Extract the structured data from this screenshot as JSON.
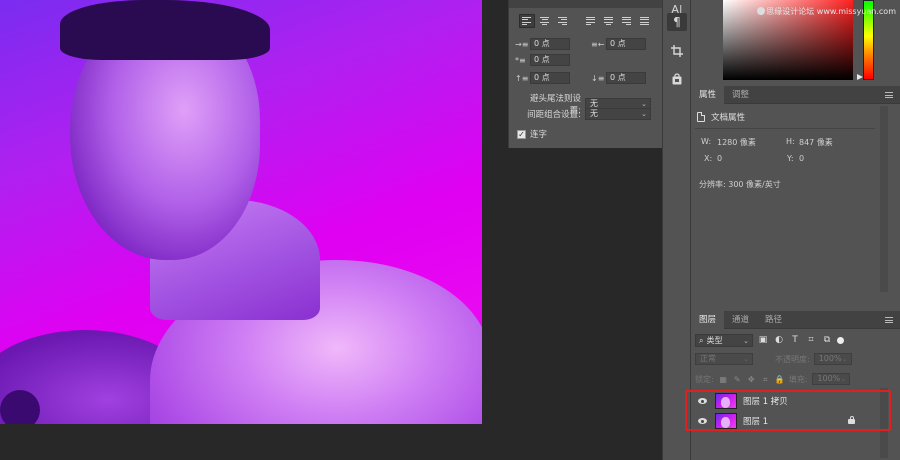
{
  "paragraph_panel": {
    "tabs": [
      "",
      ""
    ],
    "indent_left": "0 点",
    "indent_right": "0 点",
    "first_line": "0 点",
    "space_before": "0 点",
    "space_after": "0 点",
    "hyphen_rule_label": "避头尾法则设置:",
    "hyphen_rule_value": "无",
    "spacing_combo_label": "间距组合设置:",
    "spacing_combo_value": "无",
    "hyphenate_label": "连字"
  },
  "tool_strip": {
    "items": [
      "A|",
      "¶",
      "crop",
      "bag"
    ]
  },
  "watermark": "思缘设计论坛 www.missyuan.com",
  "properties_panel": {
    "tabs": [
      "属性",
      "调整"
    ],
    "section_title": "文档属性",
    "width_label": "W:",
    "width_value": "1280 像素",
    "height_label": "H:",
    "height_value": "847 像素",
    "x_label": "X:",
    "x_value": "0",
    "y_label": "Y:",
    "y_value": "0",
    "resolution": "分辨率: 300 像素/英寸"
  },
  "layers_panel": {
    "tabs": [
      "图层",
      "通道",
      "路径"
    ],
    "kind_filter": "类型",
    "blend_mode": "正常",
    "opacity_label": "不透明度:",
    "opacity_value": "100%",
    "lock_label": "锁定:",
    "fill_label": "填充:",
    "fill_value": "100%",
    "layers": [
      {
        "name": "图层 1 拷贝",
        "locked": false
      },
      {
        "name": "图层 1",
        "locked": true
      }
    ]
  },
  "colors": {
    "panel_bg": "#535353",
    "workspace_bg": "#282828",
    "highlight": "#e02020"
  }
}
